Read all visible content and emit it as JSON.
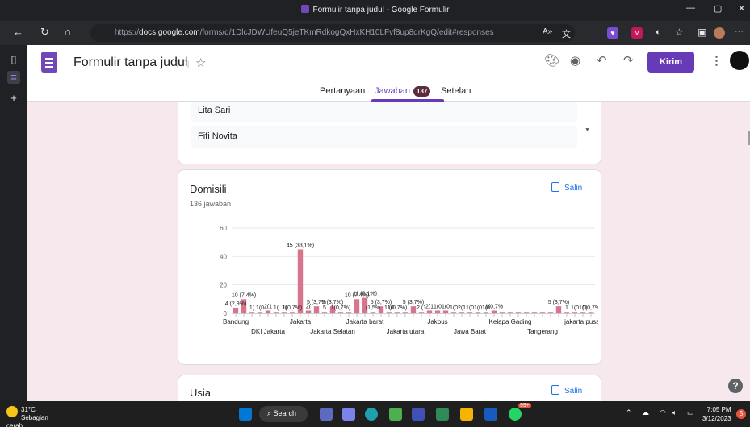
{
  "window": {
    "title": "Formulir tanpa judul - Google Formulir",
    "min": "—",
    "max": "▢",
    "close": "✕"
  },
  "browser": {
    "url_prefix": "https://",
    "url_host": "docs.google.com",
    "url_path": "/forms/d/1DlcJDWUfeuQ5jeTKmRdkogQxHxKH10LFvf8up8qrKgQ/edit#responses"
  },
  "header": {
    "doc_title": "Formulir tanpa judul",
    "send_label": "Kirim"
  },
  "tabs": [
    {
      "label": "Pertanyaan"
    },
    {
      "label": "Jawaban",
      "badge": "137"
    },
    {
      "label": "Setelan"
    }
  ],
  "name_list": [
    "Lita Sari",
    "Fifi Novita"
  ],
  "domisili": {
    "title": "Domisili",
    "count": "136 jawaban",
    "copy_label": "Salin"
  },
  "usia": {
    "title": "Usia",
    "copy_label": "Salin"
  },
  "chart_data": {
    "type": "bar",
    "ylim": [
      0,
      60
    ],
    "yticks": [
      0,
      20,
      40,
      60
    ],
    "bar_color": "#d9748d",
    "grid": true,
    "x_tick_labels_row1": [
      {
        "index": 0,
        "label": "Bandung"
      },
      {
        "index": 8,
        "label": "Jakarta"
      },
      {
        "index": 16,
        "label": "Jakarta barat"
      },
      {
        "index": 25,
        "label": "Jakpus"
      },
      {
        "index": 34,
        "label": "Kelapa Gading"
      },
      {
        "index": 43,
        "label": "jakarta pusat"
      }
    ],
    "x_tick_labels_row2": [
      {
        "index": 4,
        "label": "DKI Jakarta"
      },
      {
        "index": 12,
        "label": "Jakarta Selatan"
      },
      {
        "index": 21,
        "label": "Jakarta utara"
      },
      {
        "index": 29,
        "label": "Jawa Barat"
      },
      {
        "index": 38,
        "label": "Tangerang"
      }
    ],
    "values": [
      4,
      10,
      1,
      1,
      2,
      1,
      1,
      1,
      45,
      2,
      5,
      1,
      5,
      1,
      1,
      10,
      11,
      1,
      5,
      1,
      1,
      1,
      5,
      1,
      2,
      2,
      2,
      1,
      1,
      1,
      1,
      1,
      2,
      1,
      1,
      1,
      1,
      1,
      1,
      1,
      5,
      1,
      1,
      1,
      1
    ],
    "data_labels": [
      {
        "index": 0,
        "text": "4 (2,9%)"
      },
      {
        "index": 1,
        "text": "10 (7,4%)"
      },
      {
        "index": 2,
        "text": "1("
      },
      {
        "index": 3,
        "text": "1(0"
      },
      {
        "index": 4,
        "text": "2(1"
      },
      {
        "index": 5,
        "text": "1("
      },
      {
        "index": 6,
        "text": "1("
      },
      {
        "index": 7,
        "text": "1(0,7%)"
      },
      {
        "index": 8,
        "text": "45 (33,1%)"
      },
      {
        "index": 9,
        "text": "2("
      },
      {
        "index": 10,
        "text": "5 (3,7%"
      },
      {
        "index": 11,
        "text": "5"
      },
      {
        "index": 12,
        "text": "5 (3,7%)"
      },
      {
        "index": 13,
        "text": "1(0,7%)"
      },
      {
        "index": 15,
        "text": "10 (7,4%)"
      },
      {
        "index": 16,
        "text": "11 (8,1%)"
      },
      {
        "index": 17,
        "text": "(1,5%"
      },
      {
        "index": 18,
        "text": "5 (3,7%)"
      },
      {
        "index": 19,
        "text": "1 (0"
      },
      {
        "index": 20,
        "text": "1(0,7%)"
      },
      {
        "index": 22,
        "text": "5 (3,7%)"
      },
      {
        "index": 23,
        "text": "2 (1"
      },
      {
        "index": 24,
        "text": "2(1"
      },
      {
        "index": 25,
        "text": "1(0"
      },
      {
        "index": 26,
        "text": "1(0"
      },
      {
        "index": 27,
        "text": "1(0"
      },
      {
        "index": 28,
        "text": "2(1"
      },
      {
        "index": 29,
        "text": "1(0"
      },
      {
        "index": 30,
        "text": "1(0"
      },
      {
        "index": 31,
        "text": "1(0"
      },
      {
        "index": 32,
        "text": "1(0,7%"
      },
      {
        "index": 40,
        "text": "5 (3,7%)"
      },
      {
        "index": 41,
        "text": "1"
      },
      {
        "index": 42,
        "text": "1(0"
      },
      {
        "index": 43,
        "text": "1(0"
      },
      {
        "index": 44,
        "text": "1(0,7%"
      }
    ]
  },
  "taskbar": {
    "temp": "31°C",
    "weather": "Sebagian cerah",
    "search_label": "Search",
    "whatsapp_badge": "99+",
    "time": "7:05 PM",
    "date": "3/12/2023",
    "notif_count": "5"
  }
}
